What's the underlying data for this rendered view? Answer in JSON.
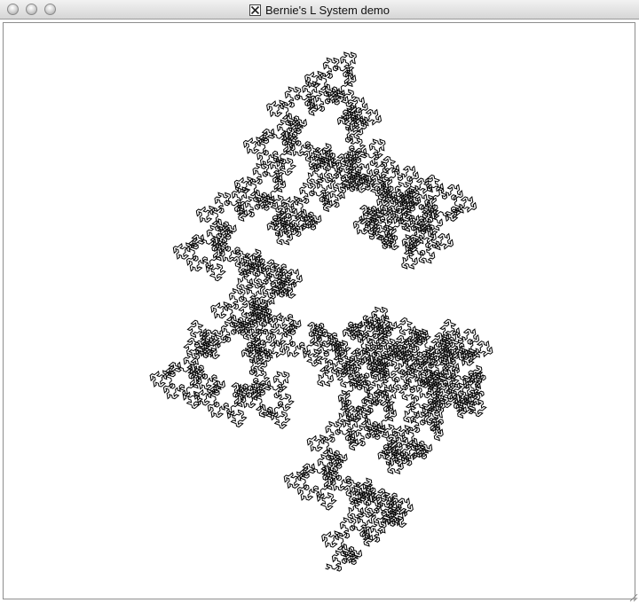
{
  "window": {
    "title": "Bernie's L System demo",
    "app_icon": "x11-icon",
    "controls": [
      "close-button",
      "minimize-button",
      "zoom-button"
    ]
  },
  "canvas": {
    "background": "#ffffff",
    "stroke_color": "#000000",
    "figure": "l-system-curve"
  },
  "chrome_colors": {
    "titlebar_top": "#f2f2f2",
    "titlebar_bottom": "#d6d6d6",
    "border": "#8d8d8d"
  }
}
